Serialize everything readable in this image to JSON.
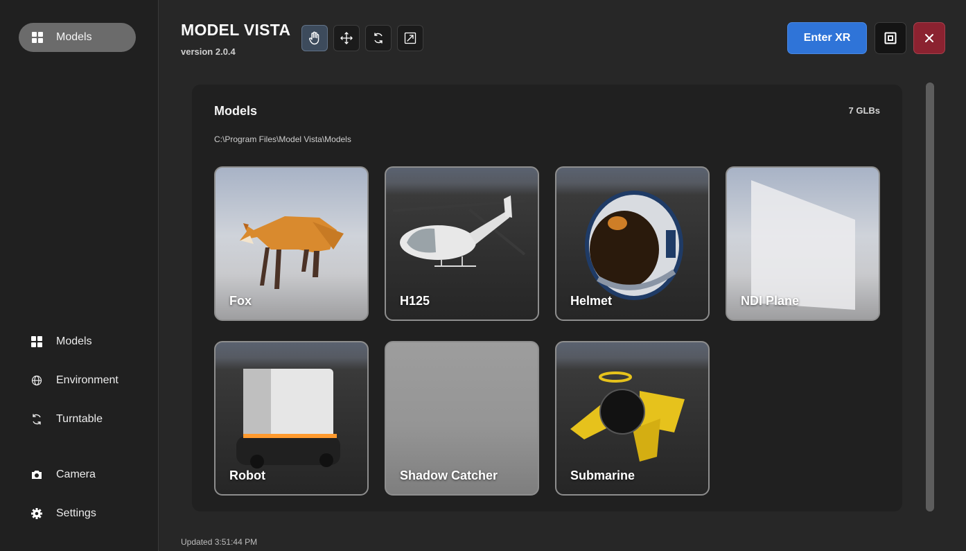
{
  "app": {
    "title": "MODEL VISTA",
    "version": "version 2.0.4"
  },
  "sidebar": {
    "top_item": {
      "label": "Models",
      "icon": "grid-icon"
    },
    "items": [
      {
        "label": "Models",
        "icon": "grid-icon"
      },
      {
        "label": "Environment",
        "icon": "globe-icon"
      },
      {
        "label": "Turntable",
        "icon": "rotate-icon"
      },
      {
        "label": "Camera",
        "icon": "camera-icon"
      },
      {
        "label": "Settings",
        "icon": "gear-icon"
      }
    ]
  },
  "toolbar": {
    "tools": [
      "hand-icon",
      "move-icon",
      "rotate-icon",
      "scale-icon"
    ],
    "active_tool": "hand-icon",
    "enter_xr_label": "Enter XR"
  },
  "panel": {
    "title": "Models",
    "count": "7 GLBs",
    "path": "C:\\Program Files\\Model Vista\\Models",
    "models": [
      {
        "name": "Fox"
      },
      {
        "name": "H125"
      },
      {
        "name": "Helmet"
      },
      {
        "name": "NDI Plane"
      },
      {
        "name": "Robot"
      },
      {
        "name": "Shadow Catcher"
      },
      {
        "name": "Submarine"
      }
    ]
  },
  "footer": {
    "status": "Updated 3:51:44 PM"
  },
  "colors": {
    "accent": "#2f74d8",
    "danger": "#8b2230",
    "active_tool": "#3d4b5c"
  }
}
